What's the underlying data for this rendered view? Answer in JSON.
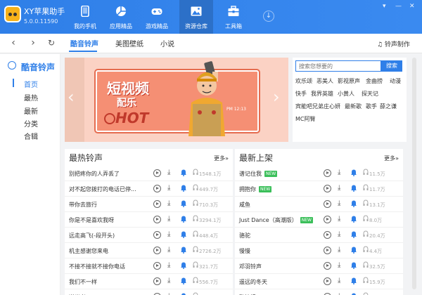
{
  "app": {
    "name": "XY苹果助手",
    "version": "5.0.0.11590"
  },
  "nav": {
    "tabs": [
      {
        "label": "我的手机",
        "icon": "phone-icon"
      },
      {
        "label": "应用精品",
        "icon": "apps-pie-icon"
      },
      {
        "label": "游戏精品",
        "icon": "gamepad-icon"
      },
      {
        "label": "资源仓库",
        "icon": "image-gallery-icon",
        "active": true
      },
      {
        "label": "工具箱",
        "icon": "toolbox-icon"
      }
    ],
    "download_glyph": "↓"
  },
  "window_controls": [
    "▾",
    "—",
    "✕"
  ],
  "subnav": {
    "back": "‹",
    "forward": "›",
    "refresh": "↻",
    "tabs": [
      "酷音铃声",
      "美图壁纸",
      "小说"
    ],
    "ringtone_make": "♫ 铃声制作"
  },
  "sidebar": {
    "title": "酷音铃声",
    "items": [
      "首页",
      "最热",
      "最新",
      "分类",
      "合辑"
    ]
  },
  "banner": {
    "title_line1": "短视频",
    "title_line2": "配乐",
    "hot": "HOT",
    "time": "PM 12:13",
    "prev": "‹",
    "next": "›"
  },
  "search": {
    "placeholder": "搜索您想要的",
    "button": "搜索",
    "tags": [
      [
        "欢乐颂",
        "恶美人",
        "影视原声",
        "金曲捞",
        "动漫"
      ],
      [
        "快手",
        "我界英雄",
        "小黄人",
        "探天记"
      ],
      [
        "宾能吧兄弟",
        "庄心妍",
        "最新歌",
        "歌手",
        "薛之谦"
      ],
      [
        "MC阿臀"
      ]
    ]
  },
  "hot_list": {
    "title": "最热铃声",
    "more": "更多»",
    "rows": [
      {
        "name": "别把疼你的人弄丢了",
        "count": "1548.1万"
      },
      {
        "name": "对不起您拨打的电话已停...",
        "count": "449.7万"
      },
      {
        "name": "带你去旅行",
        "count": "710.3万"
      },
      {
        "name": "你是不是喜欢我呀",
        "count": "3294.1万"
      },
      {
        "name": "远走高飞(-段开头)",
        "count": "448.4万"
      },
      {
        "name": "机主感谢您来电",
        "count": "2726.2万"
      },
      {
        "name": "不接不接就不接你电话",
        "count": "321.7万"
      },
      {
        "name": "我们不一样",
        "count": "556.7万"
      },
      {
        "name": "逆光者",
        "count": "784.3万"
      }
    ]
  },
  "new_list": {
    "title": "最新上架",
    "more": "更多»",
    "rows": [
      {
        "name": "谱记住我",
        "badge": "NEW",
        "count": "11.5万"
      },
      {
        "name": "拥抱你",
        "badge": "NEW",
        "count": "11.7万"
      },
      {
        "name": "咸鱼",
        "count": "13.1万"
      },
      {
        "name": "Just Dance（高潮版）",
        "badge": "NEW",
        "count": "8.0万"
      },
      {
        "name": "骆驼",
        "count": "20.4万"
      },
      {
        "name": "慢慢",
        "count": "4.4万"
      },
      {
        "name": "邓羽铃声",
        "count": "32.5万"
      },
      {
        "name": "遥远的冬天",
        "count": "15.9万"
      },
      {
        "name": "酌情境",
        "count": "15.6万"
      }
    ]
  },
  "colors": {
    "brand": "#2f7fe8",
    "new_badge": "#3bbf5a"
  }
}
